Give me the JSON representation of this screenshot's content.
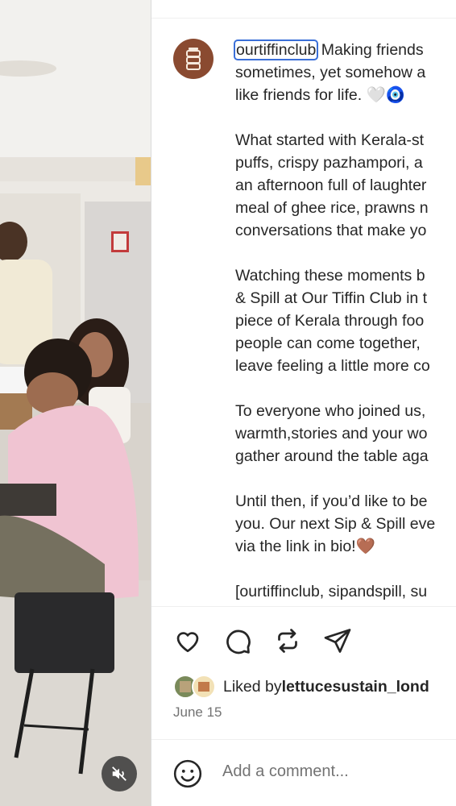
{
  "post": {
    "username": "ourtiffinclub",
    "caption_lines": [
      [
        "Making friends",
        "sometimes, yet somehow a",
        "like friends for life. 🤍🧿"
      ],
      [
        "What started with Kerala-st",
        "puffs, crispy pazhampori, a",
        "an afternoon full of laughter",
        "meal of ghee rice, prawns n",
        "conversations that make yo"
      ],
      [
        "Watching these moments b",
        "& Spill at Our Tiffin Club in t",
        "piece of Kerala through foo",
        "people can come together,",
        "leave feeling a little more co"
      ],
      [
        "To everyone who joined us,",
        "warmth,stories and your wo",
        "gather around the table aga"
      ],
      [
        "Until then, if you’d like to be",
        "you. Our next Sip & Spill eve",
        "via the link in bio!🤎"
      ],
      [
        "[ourtiffinclub, sipandspill, su"
      ]
    ],
    "liked_by_prefix": "Liked by ",
    "liked_by_user": "lettucesustain_lond",
    "date": "June 15",
    "comment_placeholder": "Add a comment..."
  },
  "icons": {
    "like": "heart-icon",
    "comment": "comment-bubble-icon",
    "repost": "repost-icon",
    "share": "paper-plane-icon",
    "emoji": "smiley-icon",
    "mute": "speaker-muted-icon"
  },
  "colors": {
    "brand_avatar": "#8a4a30",
    "highlight_outline": "#3a6fd8",
    "text": "#262626",
    "muted": "#737373"
  }
}
